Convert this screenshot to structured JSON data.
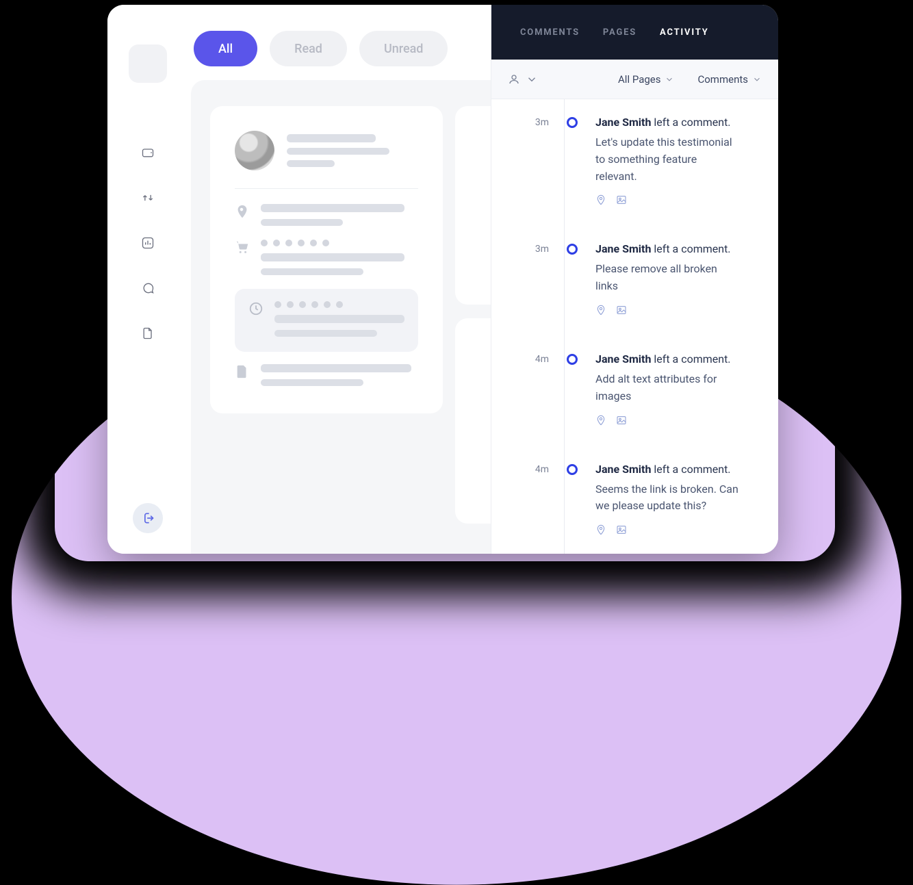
{
  "filters": {
    "all": "All",
    "read": "Read",
    "unread": "Unread"
  },
  "panel": {
    "tabs": {
      "comments": "COMMENTS",
      "pages": "PAGES",
      "activity": "ACTIVITY"
    },
    "toolbar": {
      "pages_filter": "All Pages",
      "type_filter": "Comments"
    }
  },
  "activity": [
    {
      "time": "3m",
      "author": "Jane Smith",
      "action": "left a comment.",
      "message": "Let's update this testimonial to something feature relevant."
    },
    {
      "time": "3m",
      "author": "Jane Smith",
      "action": "left a comment.",
      "message": "Please remove all broken links"
    },
    {
      "time": "4m",
      "author": "Jane Smith",
      "action": "left a comment.",
      "message": "Add alt text attributes for images"
    },
    {
      "time": "4m",
      "author": "Jane Smith",
      "action": "left a comment.",
      "message": "Seems the link is broken. Can we please update this?"
    }
  ]
}
